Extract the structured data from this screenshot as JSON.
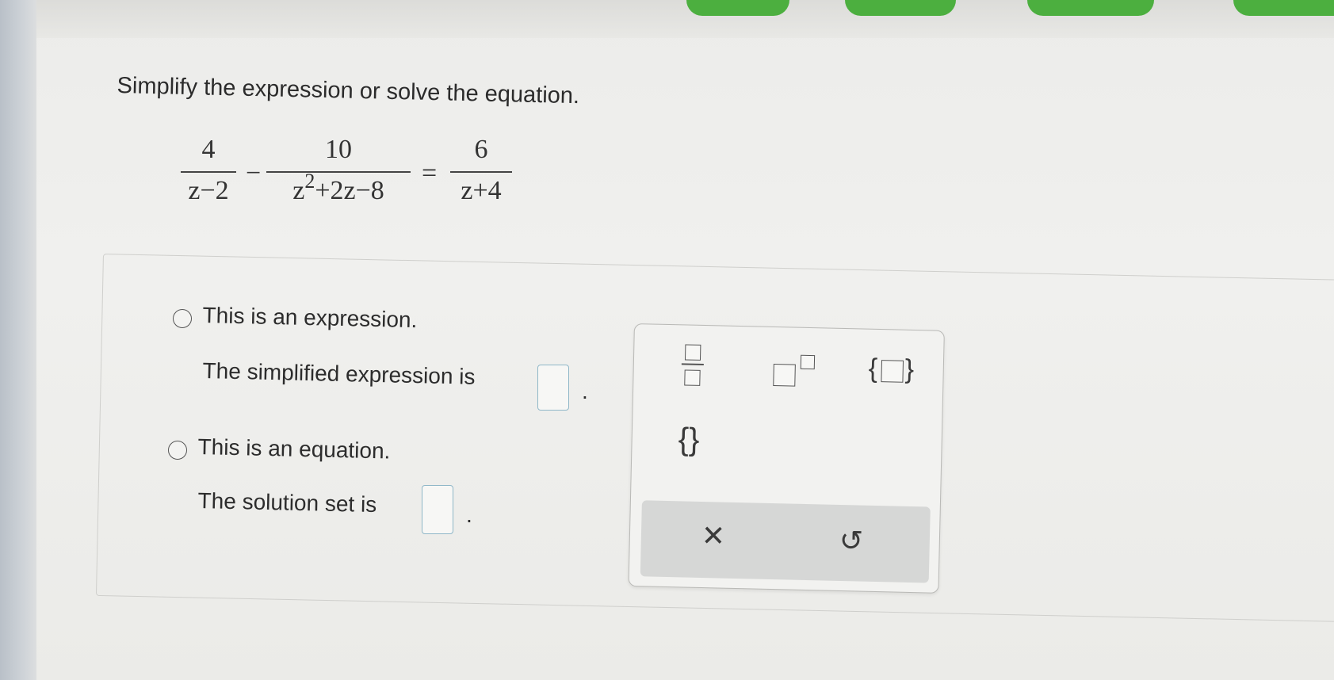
{
  "prompt": "Simplify the expression or solve the equation.",
  "equation": {
    "term1": {
      "num": "4",
      "den": "z−2"
    },
    "op1": "−",
    "term2": {
      "num": "10",
      "den_base": "z",
      "den_exp": "2",
      "den_rest": "+2z−8"
    },
    "op2": "=",
    "term3": {
      "num": "6",
      "den": "z+4"
    }
  },
  "options": [
    {
      "label": "This is an expression.",
      "answer_prefix": "The simplified expression is",
      "answer_suffix": "."
    },
    {
      "label": "This is an equation.",
      "answer_prefix": "The solution set is",
      "answer_suffix": "."
    }
  ],
  "palette": {
    "buttons": [
      "fraction-template",
      "exponent-template",
      "set-braces-with-box",
      "empty-set-braces"
    ],
    "empty_set_symbol": "{}",
    "brace_open": "{",
    "brace_close": "}",
    "clear_symbol": "✕",
    "undo_symbol": "↺"
  },
  "colors": {
    "tab_green": "#4caf3f",
    "answer_box_border": "#8fb7c8"
  }
}
